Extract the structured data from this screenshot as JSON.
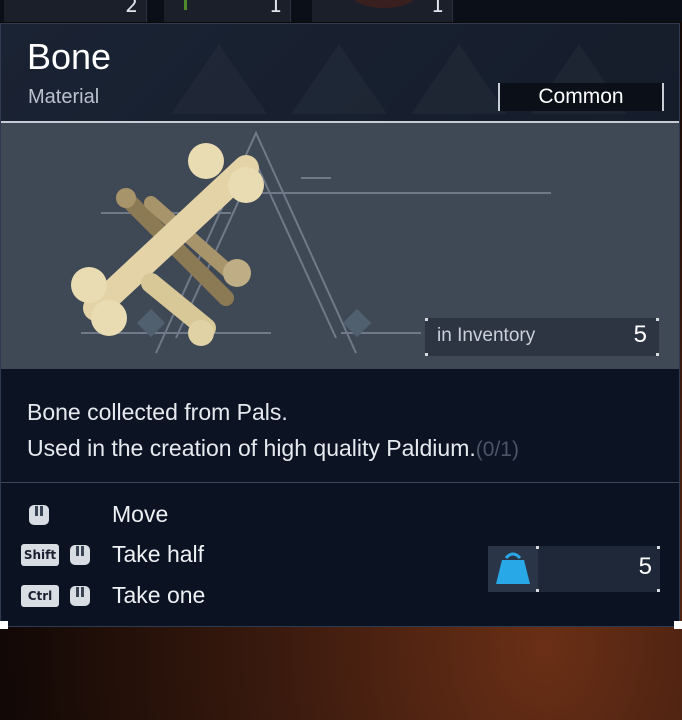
{
  "top_slots": [
    {
      "count": "2"
    },
    {
      "count": "1"
    },
    {
      "count": "1"
    }
  ],
  "item": {
    "name": "Bone",
    "category": "Material",
    "rarity": "Common",
    "inventory_label": "in Inventory",
    "inventory_count": "5",
    "description_line1": "Bone collected from Pals.",
    "description_line2": "Used in the creation of high quality Paldium.",
    "description_ghost": "(0/1)"
  },
  "controls": [
    {
      "key": "",
      "label": "Move"
    },
    {
      "key": "Shift",
      "label": "Take half"
    },
    {
      "key": "Ctrl",
      "label": "Take one"
    }
  ],
  "weight": {
    "icon": "weight-icon",
    "value": "5"
  },
  "colors": {
    "panel_bg": "#0b1323",
    "header_bg": "#1a2333",
    "image_bg": "#3f4855",
    "accent_blue": "#29a8e8",
    "text": "#e8ecf0"
  }
}
